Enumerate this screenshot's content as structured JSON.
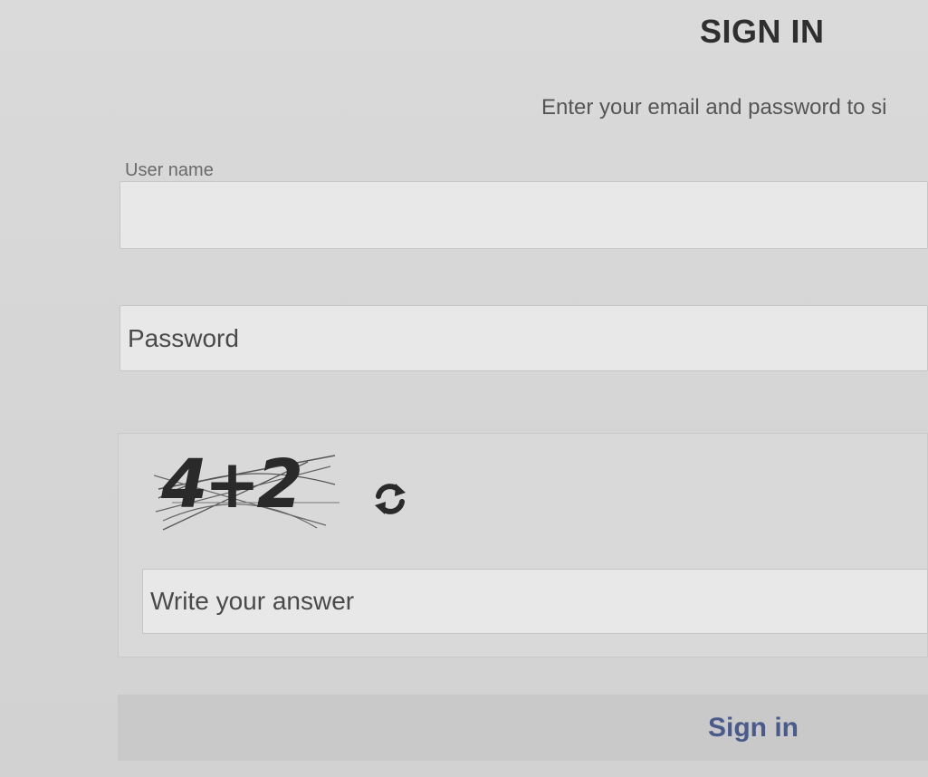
{
  "header": {
    "title": "SIGN IN",
    "subtitle": "Enter your email and password to si"
  },
  "form": {
    "username_label": "User name",
    "username_value": "",
    "password_placeholder": "Password",
    "password_value": "",
    "captcha": {
      "text": "4+2",
      "refresh_icon": "refresh-icon"
    },
    "answer_placeholder": "Write your answer",
    "answer_value": "",
    "submit_label": "Sign in"
  },
  "colors": {
    "background": "#d8d8d8",
    "submit_text": "#4a5a8a",
    "submit_background": "#c9c9c9"
  }
}
